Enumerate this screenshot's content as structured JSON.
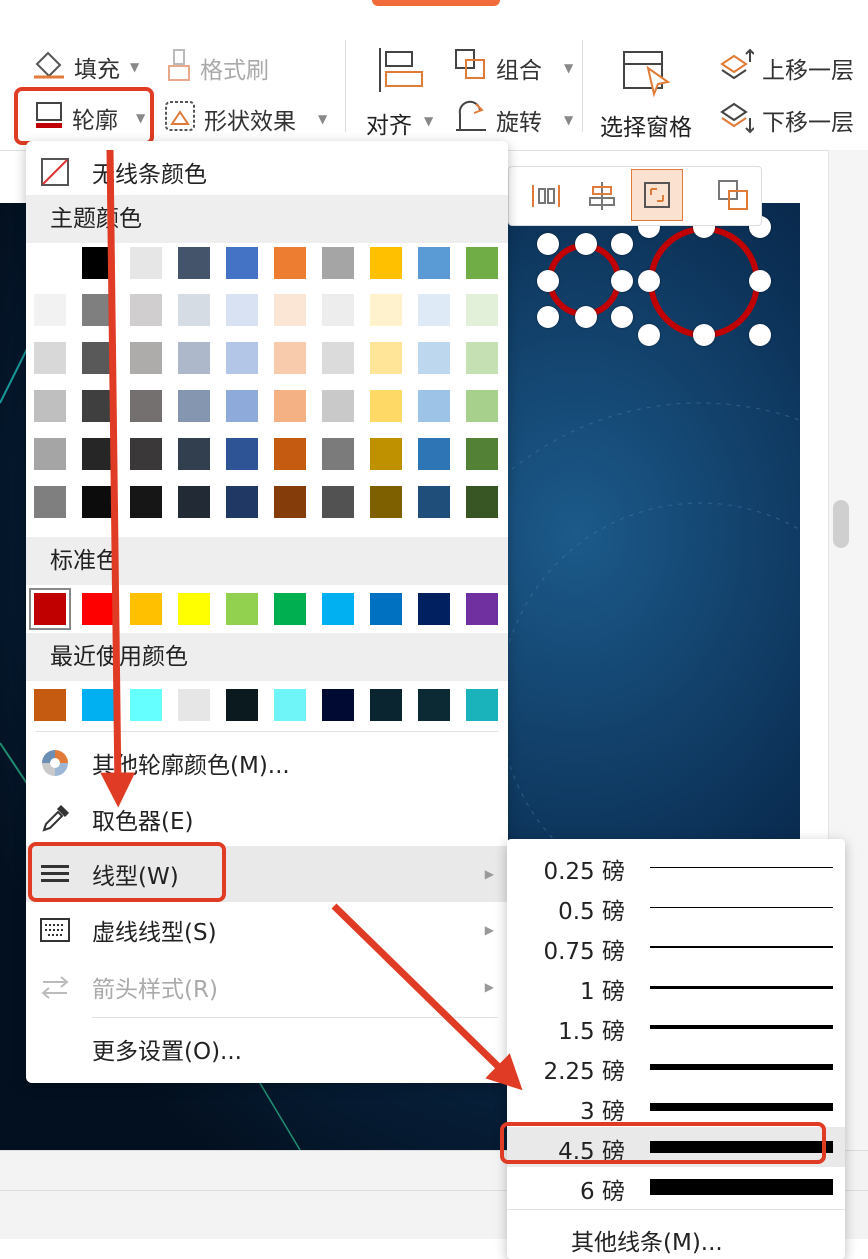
{
  "ribbon": {
    "fill": "填充",
    "format_brush": "格式刷",
    "outline": "轮廓",
    "shape_effects": "形状效果",
    "align": "对齐",
    "group": "组合",
    "rotate": "旋转",
    "selection_pane": "选择窗格",
    "bring_forward": "上移一层",
    "send_backward": "下移一层"
  },
  "menu": {
    "no_line_color": "无线条颜色",
    "theme_colors_label": "主题颜色",
    "theme_colors": [
      [
        "#ffffff",
        "#000000",
        "#e7e6e6",
        "#44546a",
        "#4472c4",
        "#ed7d31",
        "#a5a5a5",
        "#ffc000",
        "#5b9bd5",
        "#70ad47"
      ],
      [
        "#f2f2f2",
        "#7f7f7f",
        "#d0cece",
        "#d6dce4",
        "#d9e2f3",
        "#fbe5d5",
        "#ededed",
        "#fff2cc",
        "#deebf6",
        "#e2efd9"
      ],
      [
        "#d8d8d8",
        "#595959",
        "#aeabab",
        "#adb9ca",
        "#b4c6e7",
        "#f7cbac",
        "#dbdbdb",
        "#ffe598",
        "#bdd7ee",
        "#c5e0b3"
      ],
      [
        "#bfbfbf",
        "#3f3f3f",
        "#757070",
        "#8496b0",
        "#8eaadb",
        "#f4b183",
        "#c9c9c9",
        "#ffd965",
        "#9dc3e6",
        "#a8d08d"
      ],
      [
        "#a5a5a5",
        "#262626",
        "#3a3838",
        "#323f4f",
        "#2f5496",
        "#c55a11",
        "#7b7b7b",
        "#bf9000",
        "#2e75b5",
        "#538135"
      ],
      [
        "#7f7f7f",
        "#0c0c0c",
        "#171616",
        "#222a35",
        "#1f3864",
        "#843c0b",
        "#525252",
        "#7f6000",
        "#1e4e79",
        "#375623"
      ]
    ],
    "standard_colors_label": "标准色",
    "standard_colors": [
      "#c00000",
      "#ff0000",
      "#ffc000",
      "#ffff00",
      "#92d050",
      "#00b050",
      "#00b0f0",
      "#0070c0",
      "#002060",
      "#7030a0"
    ],
    "recent_colors_label": "最近使用颜色",
    "recent_colors": [
      "#c55a11",
      "#00b0f0",
      "#66ffff",
      "#e7e6e6",
      "#0a1a1f",
      "#6ff5f7",
      "#000a33",
      "#0b2530",
      "#0c2a33",
      "#1ab3bb"
    ],
    "more_outline_colors": "其他轮廓颜色(M)...",
    "eyedropper": "取色器(E)",
    "line_style": "线型(W)",
    "dash_style": "虚线线型(S)",
    "arrow_style": "箭头样式(R)",
    "more_settings": "更多设置(O)..."
  },
  "submenu": {
    "weights": [
      {
        "label": "0.25 磅",
        "pt": 0.25
      },
      {
        "label": "0.5 磅",
        "pt": 0.5
      },
      {
        "label": "0.75 磅",
        "pt": 0.75
      },
      {
        "label": "1 磅",
        "pt": 1
      },
      {
        "label": "1.5 磅",
        "pt": 1.5
      },
      {
        "label": "2.25 磅",
        "pt": 2.25
      },
      {
        "label": "3 磅",
        "pt": 3
      },
      {
        "label": "4.5 磅",
        "pt": 4.5
      },
      {
        "label": "6 磅",
        "pt": 6
      }
    ],
    "other_lines": "其他线条(M)...",
    "selected_weight": "4.5 磅"
  },
  "colors": {
    "annotation_red": "#e03b24",
    "outline_accent": "#c00000",
    "ribbon_icon_orange": "#e07b39"
  }
}
